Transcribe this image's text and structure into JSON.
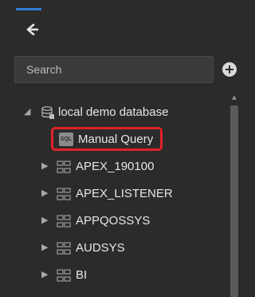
{
  "header": {
    "active_tab_icon": "connections-icon"
  },
  "search": {
    "placeholder": "Search",
    "value": ""
  },
  "toolbar": {
    "add_icon": "plus-circle-icon"
  },
  "colors": {
    "background": "#2b2b2b",
    "accent": "#2f7fd6",
    "highlight_border": "#e0212a"
  },
  "tree": {
    "root": {
      "label": "local demo database",
      "icon": "database-icon",
      "expanded": true
    },
    "manual_query": {
      "label": "Manual Query",
      "icon": "sql-icon",
      "badge_text": "SQL"
    },
    "schemas": [
      {
        "label": "APEX_190100",
        "icon": "schema-icon"
      },
      {
        "label": "APEX_LISTENER",
        "icon": "schema-icon"
      },
      {
        "label": "APPQOSSYS",
        "icon": "schema-icon"
      },
      {
        "label": "AUDSYS",
        "icon": "schema-icon"
      },
      {
        "label": "BI",
        "icon": "schema-icon"
      }
    ]
  }
}
